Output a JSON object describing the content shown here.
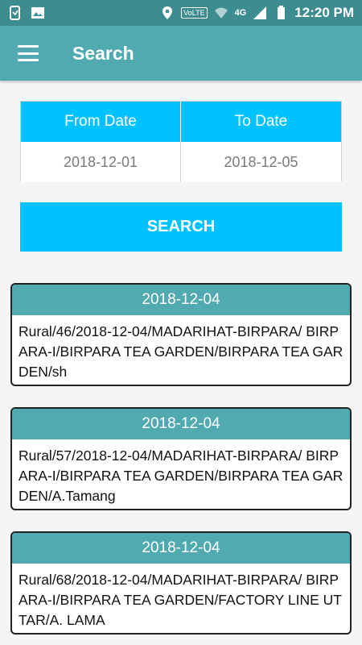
{
  "status_bar": {
    "time": "12:20 PM",
    "network": "4G",
    "volte": "VoLTE",
    "icons": [
      "phone-screen-icon",
      "image-icon",
      "location-icon",
      "wifi-icon",
      "signal-icon",
      "battery-icon"
    ]
  },
  "app_bar": {
    "title": "Search",
    "menu_icon": "hamburger-icon"
  },
  "date_filter": {
    "from_label": "From Date",
    "to_label": "To Date",
    "from_value": "2018-12-01",
    "to_value": "2018-12-05"
  },
  "search_button": {
    "label": "SEARCH"
  },
  "results": [
    {
      "date": "2018-12-04",
      "text": "Rural/46/2018-12-04/MADARIHAT-BIRPARA/ BIRPARA-I/BIRPARA TEA GARDEN/BIRPARA TEA GARDEN/sh"
    },
    {
      "date": "2018-12-04",
      "text": "Rural/57/2018-12-04/MADARIHAT-BIRPARA/ BIRPARA-I/BIRPARA TEA GARDEN/BIRPARA TEA GARDEN/A.Tamang"
    },
    {
      "date": "2018-12-04",
      "text": "Rural/68/2018-12-04/MADARIHAT-BIRPARA/ BIRPARA-I/BIRPARA TEA GARDEN/FACTORY LINE UTTAR/A. LAMA"
    }
  ],
  "colors": {
    "status_bar": "#3d8c8f",
    "app_bar": "#51aab0",
    "accent": "#00c2ff",
    "card_header": "#51aab0"
  }
}
